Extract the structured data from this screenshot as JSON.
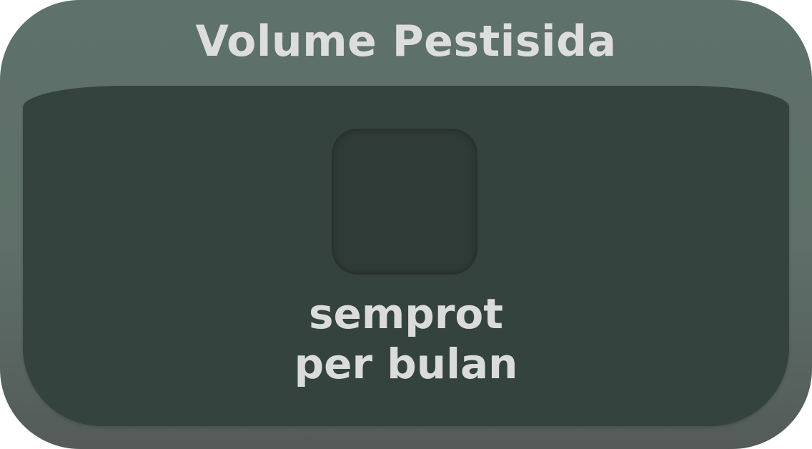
{
  "widget": {
    "title": "Volume Pestisida",
    "value": "",
    "unit_line1": "semprot",
    "unit_line2": "per bulan"
  }
}
